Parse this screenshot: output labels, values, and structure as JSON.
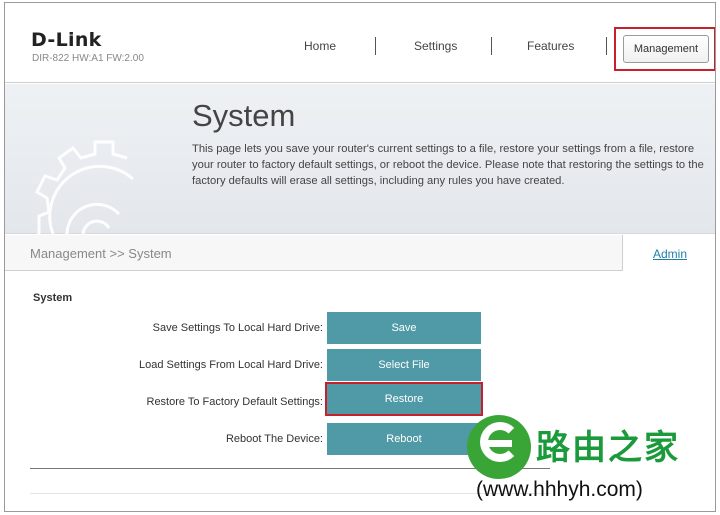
{
  "header": {
    "logo": "D-Link",
    "model": "DIR-822 HW:A1 FW:2.00",
    "nav": [
      "Home",
      "Settings",
      "Features",
      "Management"
    ],
    "active_nav": "Management"
  },
  "banner": {
    "title": "System",
    "description": "This page lets you save your router's current settings to a file, restore your settings from a file, restore your router to factory default settings, or reboot the device. Please note that restoring the settings to the factory defaults will erase all settings, including any rules you have created.",
    "icon": "gear-icon"
  },
  "breadcrumb": {
    "text": "Management >> System",
    "admin_link": "Admin"
  },
  "section": {
    "title": "System",
    "rows": [
      {
        "label": "Save Settings To Local Hard Drive:",
        "button": "Save"
      },
      {
        "label": "Load Settings From Local Hard Drive:",
        "button": "Select File"
      },
      {
        "label": "Restore To Factory Default Settings:",
        "button": "Restore"
      },
      {
        "label": "Reboot The Device:",
        "button": "Reboot"
      }
    ]
  },
  "watermark": {
    "cn": "路由之家",
    "url": "(www.hhhyh.com)"
  },
  "colors": {
    "accent_button": "#4f9aa6",
    "highlight": "#c8202a",
    "link": "#1f7fa6",
    "watermark_green": "#3aa537"
  }
}
